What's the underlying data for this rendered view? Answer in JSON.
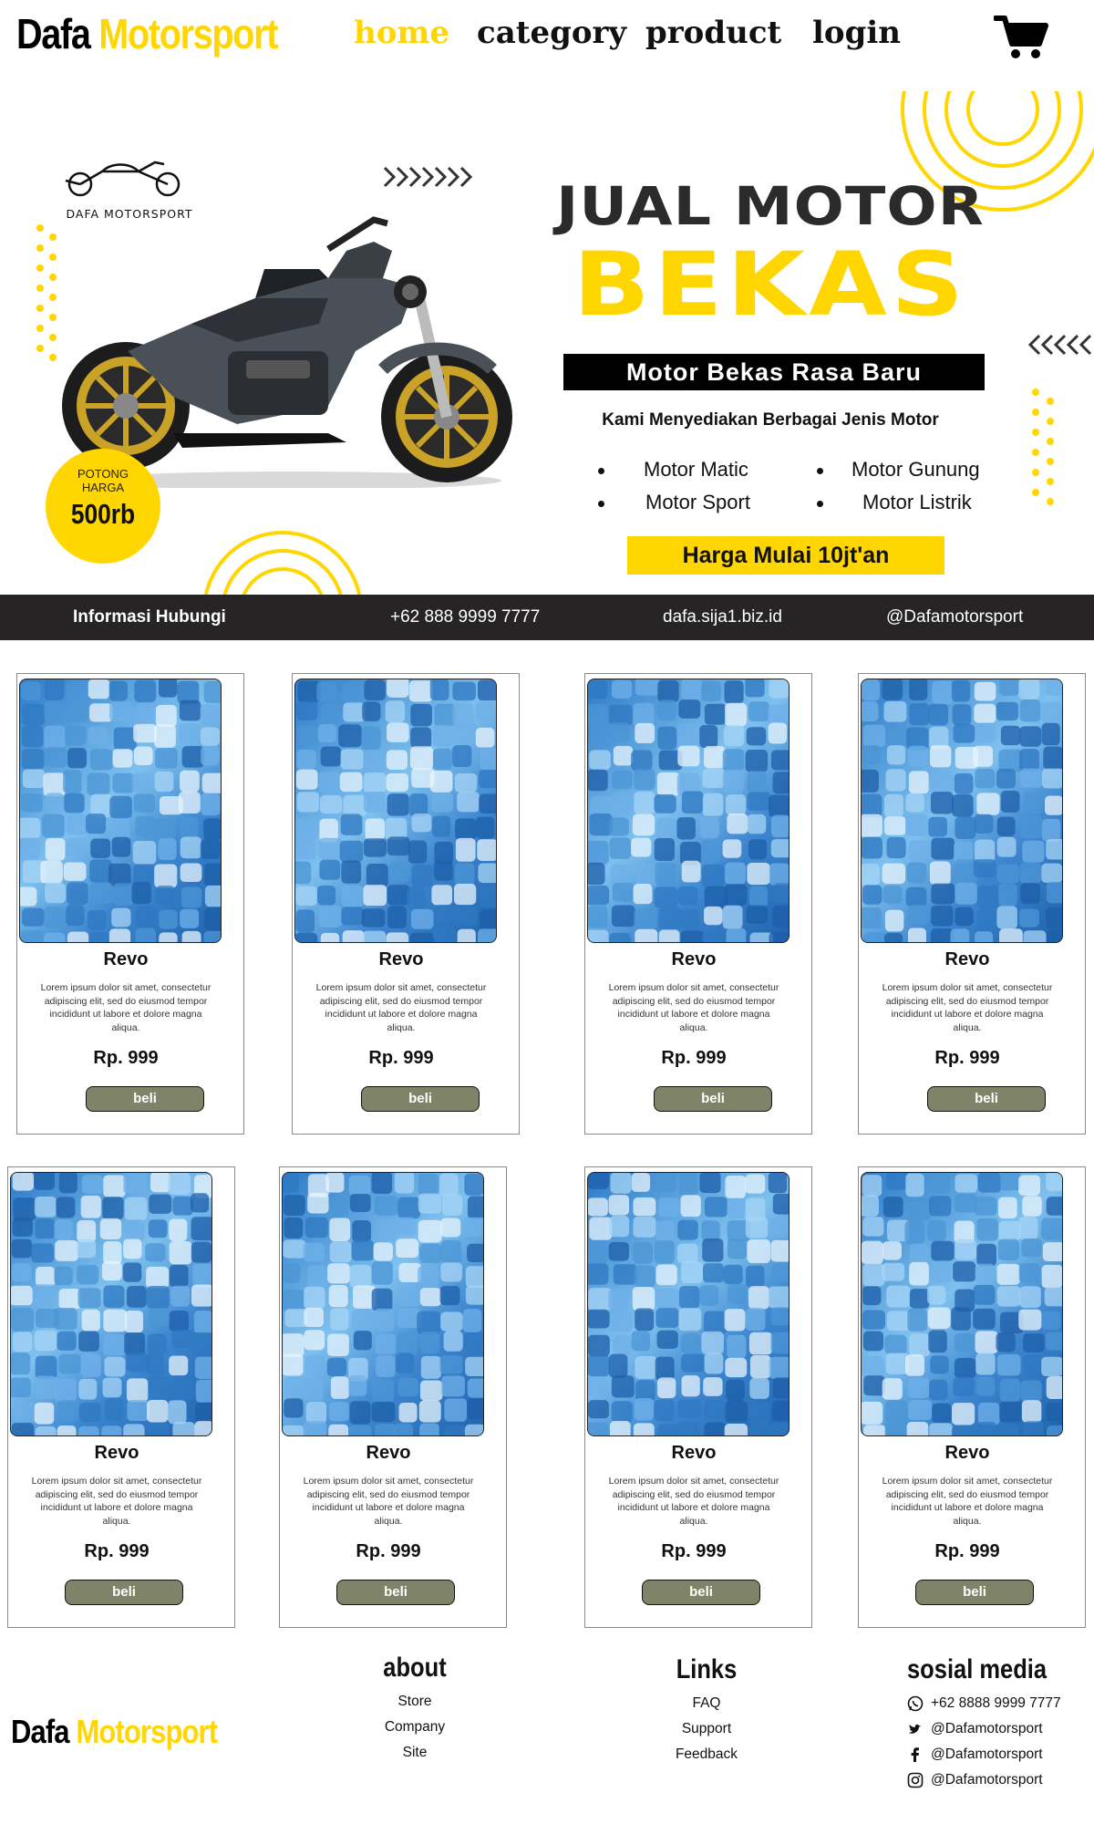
{
  "brand": {
    "word1": "Dafa",
    "word2": "Motorsport"
  },
  "colors": {
    "accent": "#ffd600",
    "dark": "#262424",
    "button": "#7f8469"
  },
  "nav": {
    "items": [
      {
        "label": "home",
        "active": true
      },
      {
        "label": "category",
        "active": false
      },
      {
        "label": "product",
        "active": false
      },
      {
        "label": "login",
        "active": false
      }
    ],
    "cart_icon": "cart-icon"
  },
  "hero": {
    "brand_mark": "DAFA MOTORSPORT",
    "title_line1": "JUAL MOTOR",
    "title_line2": "BEKAS",
    "tagline": "Motor Bekas Rasa Baru",
    "subtitle": "Kami Menyediakan Berbagai Jenis Motor",
    "types": [
      "Motor Matic",
      "Motor Gunung",
      "Motor Sport",
      "Motor Listrik"
    ],
    "badge_line1": "POTONG",
    "badge_line2": "HARGA",
    "badge_value": "500rb",
    "price_banner": "Harga Mulai 10jt'an"
  },
  "contact_bar": {
    "title": "Informasi Hubungi",
    "phone": "+62 888 9999 7777",
    "website": "dafa.sija1.biz.id",
    "social": "@Dafamotorsport"
  },
  "products": [
    {
      "name": "Revo",
      "description": "Lorem ipsum dolor sit amet, consectetur adipiscing elit, sed do eiusmod tempor incididunt ut labore et dolore magna aliqua.",
      "price": "Rp. 999",
      "button": "beli"
    },
    {
      "name": "Revo",
      "description": "Lorem ipsum dolor sit amet, consectetur adipiscing elit, sed do eiusmod tempor incididunt ut labore et dolore magna aliqua.",
      "price": "Rp. 999",
      "button": "beli"
    },
    {
      "name": "Revo",
      "description": "Lorem ipsum dolor sit amet, consectetur adipiscing elit, sed do eiusmod tempor incididunt ut labore et dolore magna aliqua.",
      "price": "Rp. 999",
      "button": "beli"
    },
    {
      "name": "Revo",
      "description": "Lorem ipsum dolor sit amet, consectetur adipiscing elit, sed do eiusmod tempor incididunt ut labore et dolore magna aliqua.",
      "price": "Rp. 999",
      "button": "beli"
    },
    {
      "name": "Revo",
      "description": "Lorem ipsum dolor sit amet, consectetur adipiscing elit, sed do eiusmod tempor incididunt ut labore et dolore magna aliqua.",
      "price": "Rp. 999",
      "button": "beli"
    },
    {
      "name": "Revo",
      "description": "Lorem ipsum dolor sit amet, consectetur adipiscing elit, sed do eiusmod tempor incididunt ut labore et dolore magna aliqua.",
      "price": "Rp. 999",
      "button": "beli"
    },
    {
      "name": "Revo",
      "description": "Lorem ipsum dolor sit amet, consectetur adipiscing elit, sed do eiusmod tempor incididunt ut labore et dolore magna aliqua.",
      "price": "Rp. 999",
      "button": "beli"
    },
    {
      "name": "Revo",
      "description": "Lorem ipsum dolor sit amet, consectetur adipiscing elit, sed do eiusmod tempor incididunt ut labore et dolore magna aliqua.",
      "price": "Rp. 999",
      "button": "beli"
    }
  ],
  "footer": {
    "about": {
      "title": "about",
      "links": [
        "Store",
        "Company",
        "Site"
      ]
    },
    "links": {
      "title": "Links",
      "links": [
        "FAQ",
        "Support",
        "Feedback"
      ]
    },
    "social": {
      "title": "sosial media",
      "items": [
        {
          "icon": "whatsapp-icon",
          "text": "+62 8888 9999 7777"
        },
        {
          "icon": "twitter-icon",
          "text": "@Dafamotorsport"
        },
        {
          "icon": "facebook-icon",
          "text": "@Dafamotorsport"
        },
        {
          "icon": "instagram-icon",
          "text": "@Dafamotorsport"
        }
      ]
    }
  }
}
